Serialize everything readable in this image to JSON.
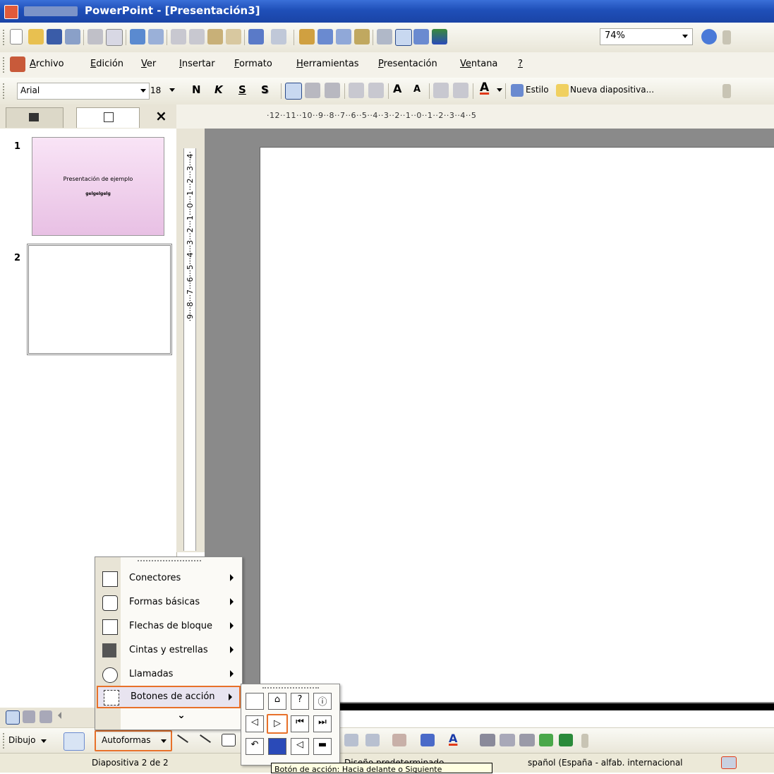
{
  "window": {
    "title": "PowerPoint - [Presentación3]"
  },
  "menubar": {
    "items": [
      {
        "u": "A",
        "rest": "rchivo"
      },
      {
        "u": "E",
        "rest": "dición"
      },
      {
        "u": "V",
        "rest": "er"
      },
      {
        "u": "I",
        "rest": "nsertar"
      },
      {
        "u": "F",
        "rest": "ormato"
      },
      {
        "u": "H",
        "rest": "erramientas"
      },
      {
        "u": "P",
        "rest": "resentación"
      },
      {
        "u": "Ve",
        "rest": "ntana"
      },
      {
        "u": "?",
        "rest": ""
      }
    ]
  },
  "toolbar_std": {
    "zoom": "74%"
  },
  "toolbar_fmt": {
    "font": "Arial",
    "size": "18",
    "bold": "N",
    "italic": "K",
    "underline": "S",
    "shadow": "S",
    "grow": "A",
    "shrink": "A",
    "font_color": "A",
    "style_label": "Estilo",
    "new_slide_label": "Nueva diapositiva..."
  },
  "pane": {
    "close": "×",
    "slides": [
      {
        "number": "1",
        "title": "Presentación de ejemplo",
        "subtitle": "gelgelgelg"
      },
      {
        "number": "2"
      }
    ]
  },
  "ruler": {
    "horizontal": "·12··11··10··9··8··7··6··5··4··3··2··1··0··1··2··3··4··5",
    "vertical": "·9···8···7···6···5···4···3···2···1···0···1···2···3···4·"
  },
  "autoshapes_menu": {
    "items": [
      {
        "label": "Conectores",
        "icon": "connector-icon"
      },
      {
        "label": "Formas básicas",
        "icon": "basic-shapes-icon"
      },
      {
        "label": "Flechas de bloque",
        "icon": "block-arrows-icon"
      },
      {
        "label": "Cintas y estrellas",
        "icon": "stars-banners-icon"
      },
      {
        "label": "Llamadas",
        "icon": "callouts-icon"
      },
      {
        "label": "Botones de acción",
        "icon": "action-buttons-icon"
      }
    ],
    "more": "⌄"
  },
  "drawing_toolbar": {
    "draw_label": "Dibujo",
    "autoshapes_label": "Autoformas",
    "font_color": "A"
  },
  "statusbar": {
    "slide_info": "Diapositiva 2 de 2",
    "design": "Diseño predeterminado",
    "language": "spañol (España - alfab. internacional"
  },
  "tooltip": {
    "text": "Botón de acción: Hacia delante o Siguiente"
  },
  "colors": {
    "highlight": "#e8712a",
    "titlebar": "#1f4fb8",
    "thumb_bg": "#f2d4ef"
  }
}
